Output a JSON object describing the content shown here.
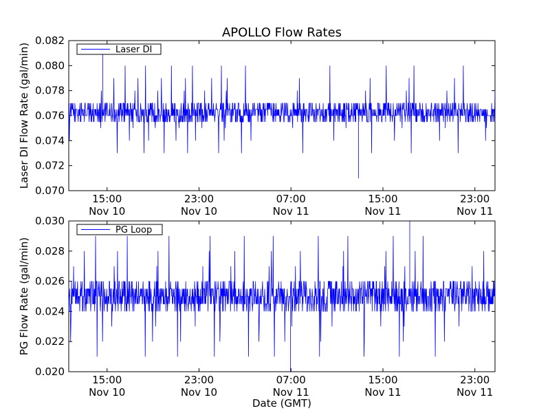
{
  "figure": {
    "title": "APOLLO Flow Rates",
    "xlabel": "Date (GMT)"
  },
  "chart_data": [
    {
      "type": "line",
      "title": "APOLLO Flow Rates",
      "ylabel": "Laser DI Flow Rate (gal/min)",
      "xlabel": "",
      "ylim": [
        0.07,
        0.082
      ],
      "yticks": [
        "0.070",
        "0.072",
        "0.074",
        "0.076",
        "0.078",
        "0.080",
        "0.082"
      ],
      "xlim": [
        "2013-11-10 11:40",
        "2013-11-12 00:45"
      ],
      "xticks": [
        {
          "time": "2013-11-10 15:00",
          "line1": "15:00",
          "line2": "Nov 10"
        },
        {
          "time": "2013-11-10 23:00",
          "line1": "23:00",
          "line2": "Nov 10"
        },
        {
          "time": "2013-11-11 07:00",
          "line1": "07:00",
          "line2": "Nov 11"
        },
        {
          "time": "2013-11-11 15:00",
          "line1": "15:00",
          "line2": "Nov 11"
        },
        {
          "time": "2013-11-11 23:00",
          "line1": "23:00",
          "line2": "Nov 11"
        }
      ],
      "legend": "top-left",
      "grid": false,
      "series": [
        {
          "name": "Laser DI",
          "color": "#0000ff",
          "typical_range": [
            0.0755,
            0.077
          ],
          "excursions": [
            0.074,
            0.075,
            0.078,
            0.079,
            0.073,
            0.08
          ],
          "min": 0.071,
          "max": 0.081
        }
      ]
    },
    {
      "type": "line",
      "ylabel": "PG Flow Rate (gal/min)",
      "xlabel": "Date (GMT)",
      "ylim": [
        0.02,
        0.03
      ],
      "yticks": [
        "0.020",
        "0.022",
        "0.024",
        "0.026",
        "0.028",
        "0.030"
      ],
      "xlim": [
        "2013-11-10 11:40",
        "2013-11-12 00:45"
      ],
      "xticks": [
        {
          "time": "2013-11-10 15:00",
          "line1": "15:00",
          "line2": "Nov 10"
        },
        {
          "time": "2013-11-10 23:00",
          "line1": "23:00",
          "line2": "Nov 10"
        },
        {
          "time": "2013-11-11 07:00",
          "line1": "07:00",
          "line2": "Nov 11"
        },
        {
          "time": "2013-11-11 15:00",
          "line1": "15:00",
          "line2": "Nov 11"
        },
        {
          "time": "2013-11-11 23:00",
          "line1": "23:00",
          "line2": "Nov 11"
        }
      ],
      "legend": "top-left",
      "grid": false,
      "series": [
        {
          "name": "PG Loop",
          "color": "#0000ff",
          "typical_range": [
            0.024,
            0.026
          ],
          "excursions": [
            0.022,
            0.023,
            0.027,
            0.028,
            0.029,
            0.021
          ],
          "min": 0.02,
          "max": 0.03
        }
      ]
    }
  ]
}
